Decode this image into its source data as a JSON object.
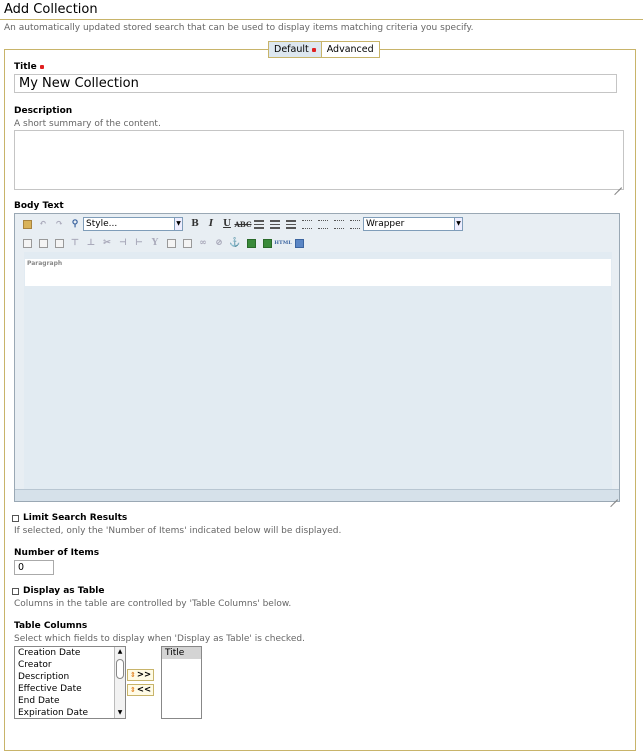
{
  "page": {
    "title": "Add Collection",
    "description": "An automatically updated stored search that can be used to display items matching criteria you specify."
  },
  "tabs": [
    {
      "label": "Default",
      "active": true,
      "required": true
    },
    {
      "label": "Advanced",
      "active": false,
      "required": false
    }
  ],
  "fields": {
    "title": {
      "label": "Title",
      "required": true,
      "value": "My New Collection"
    },
    "description": {
      "label": "Description",
      "help": "A short summary of the content.",
      "value": ""
    },
    "body_text": {
      "label": "Body Text",
      "style_select": "Style...",
      "wrapper_select": "Wrapper",
      "paragraph_label": "Paragraph"
    },
    "limit_search": {
      "label": "Limit Search Results",
      "help": "If selected, only the 'Number of Items' indicated below will be displayed.",
      "checked": false
    },
    "number_of_items": {
      "label": "Number of Items",
      "value": "0"
    },
    "display_as_table": {
      "label": "Display as Table",
      "help": "Columns in the table are controlled by 'Table Columns' below.",
      "checked": false
    },
    "table_columns": {
      "label": "Table Columns",
      "help": "Select which fields to display when 'Display as Table' is checked.",
      "available": [
        "Creation Date",
        "Creator",
        "Description",
        "Effective Date",
        "End Date",
        "Expiration Date"
      ],
      "selected": [
        "Title"
      ],
      "add_label": ">>",
      "remove_label": "<<"
    }
  },
  "colors": {
    "accent_border": "#c8b46a",
    "required_marker": "#e02020",
    "editor_bg": "#e8eef3"
  }
}
